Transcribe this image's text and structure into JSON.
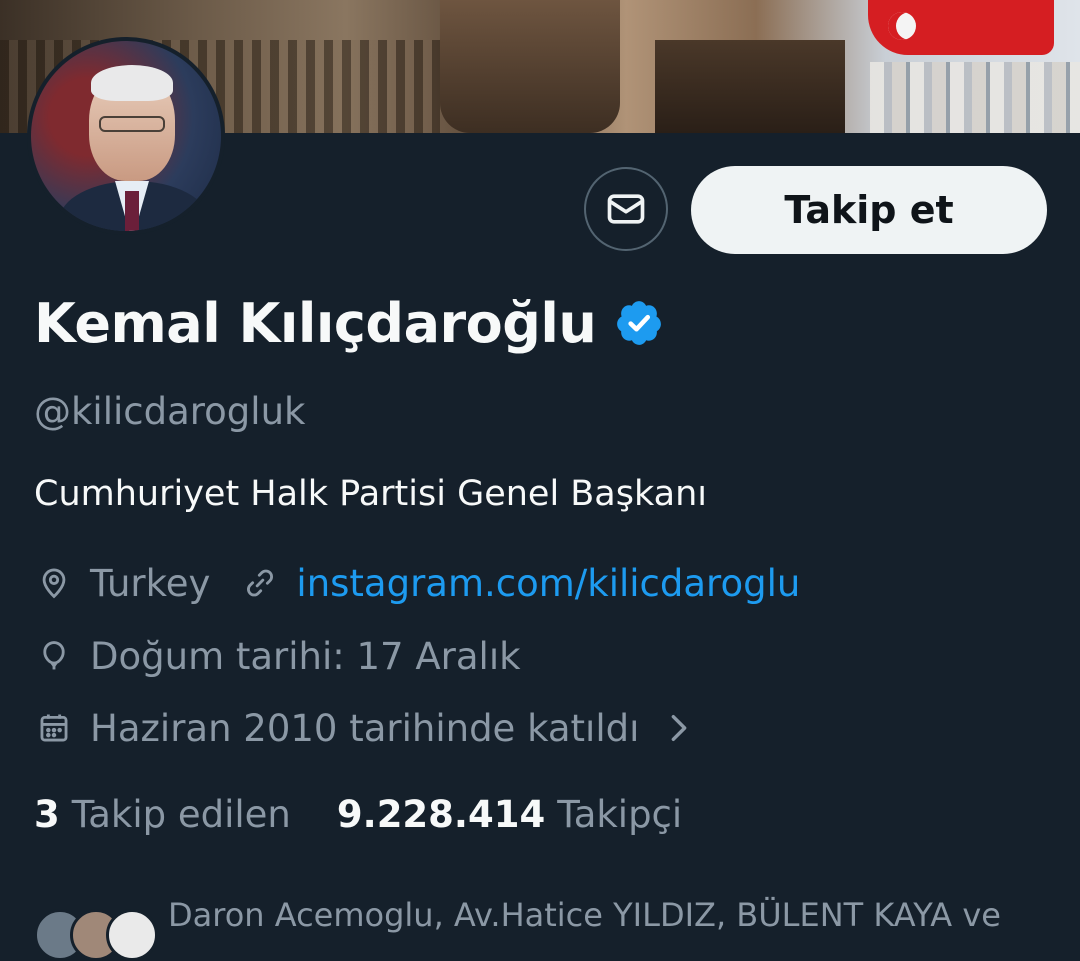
{
  "profile": {
    "name": "Kemal Kılıçdaroğlu",
    "handle": "@kilicdarogluk",
    "bio": "Cumhuriyet Halk Partisi Genel Başkanı",
    "location": "Turkey",
    "website": "instagram.com/kilicdaroglu",
    "birthday": "Doğum tarihi: 17 Aralık",
    "joined": "Haziran 2010 tarihinde katıldı"
  },
  "actions": {
    "follow_label": "Takip et"
  },
  "stats": {
    "following_count": "3",
    "following_label": "Takip edilen",
    "followers_count": "9.228.414",
    "followers_label": "Takipçi"
  },
  "followed_by": {
    "text": "Daron Acemoglu, Av.Hatice YILDIZ, BÜLENT KAYA ve"
  },
  "colors": {
    "background": "#15202b",
    "accent": "#1d9bf0",
    "secondary_text": "#8b98a5",
    "verified": "#1d9bf0"
  },
  "icons": {
    "message": "envelope-icon",
    "verified": "verified-badge-icon",
    "location": "location-pin-icon",
    "link": "link-icon",
    "birthday": "balloon-icon",
    "joined": "calendar-icon",
    "more": "chevron-right-icon"
  }
}
